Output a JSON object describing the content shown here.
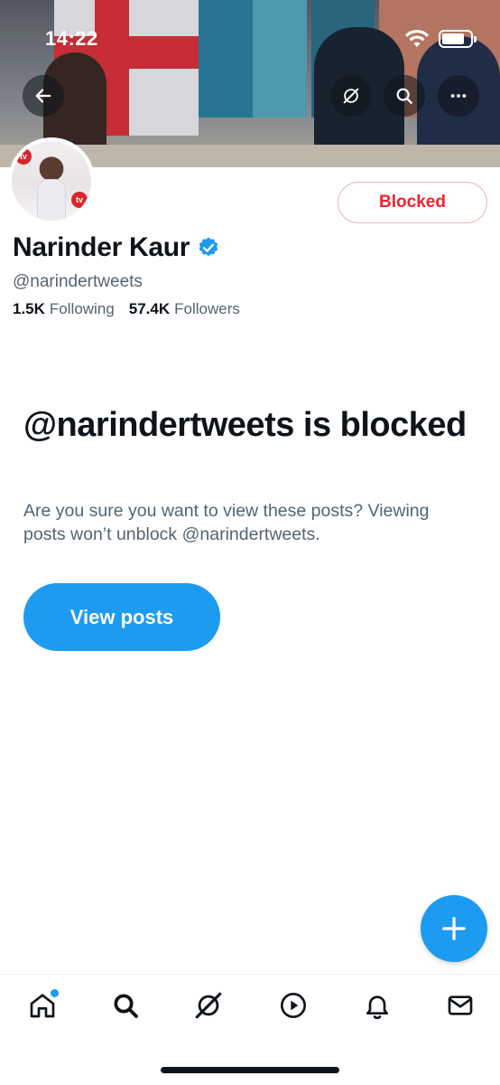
{
  "status_bar": {
    "time": "14:22"
  },
  "profile": {
    "name": "Narinder Kaur",
    "handle": "@narindertweets",
    "following_count": "1.5K",
    "following_label": "Following",
    "followers_count": "57.4K",
    "followers_label": "Followers",
    "blocked_button_label": "Blocked",
    "avatar_badge_text": "tv"
  },
  "notice": {
    "title": "@narindertweets is blocked",
    "body": "Are you sure you want to view these posts? Viewing posts won’t unblock @narindertweets.",
    "view_button_label": "View posts"
  },
  "colors": {
    "accent": "#1d9bf0",
    "blocked_red": "#f4212e",
    "text_primary": "#0f1419",
    "text_secondary": "#536471"
  },
  "icons": {
    "back": "arrow-left-icon",
    "grok": "grok-icon",
    "search": "search-icon",
    "more": "more-horizontal-icon",
    "verified": "verified-badge-icon",
    "compose": "plus-icon",
    "nav": [
      "home-icon",
      "search-icon",
      "grok-icon",
      "video-icon",
      "bell-icon",
      "mail-icon"
    ]
  }
}
